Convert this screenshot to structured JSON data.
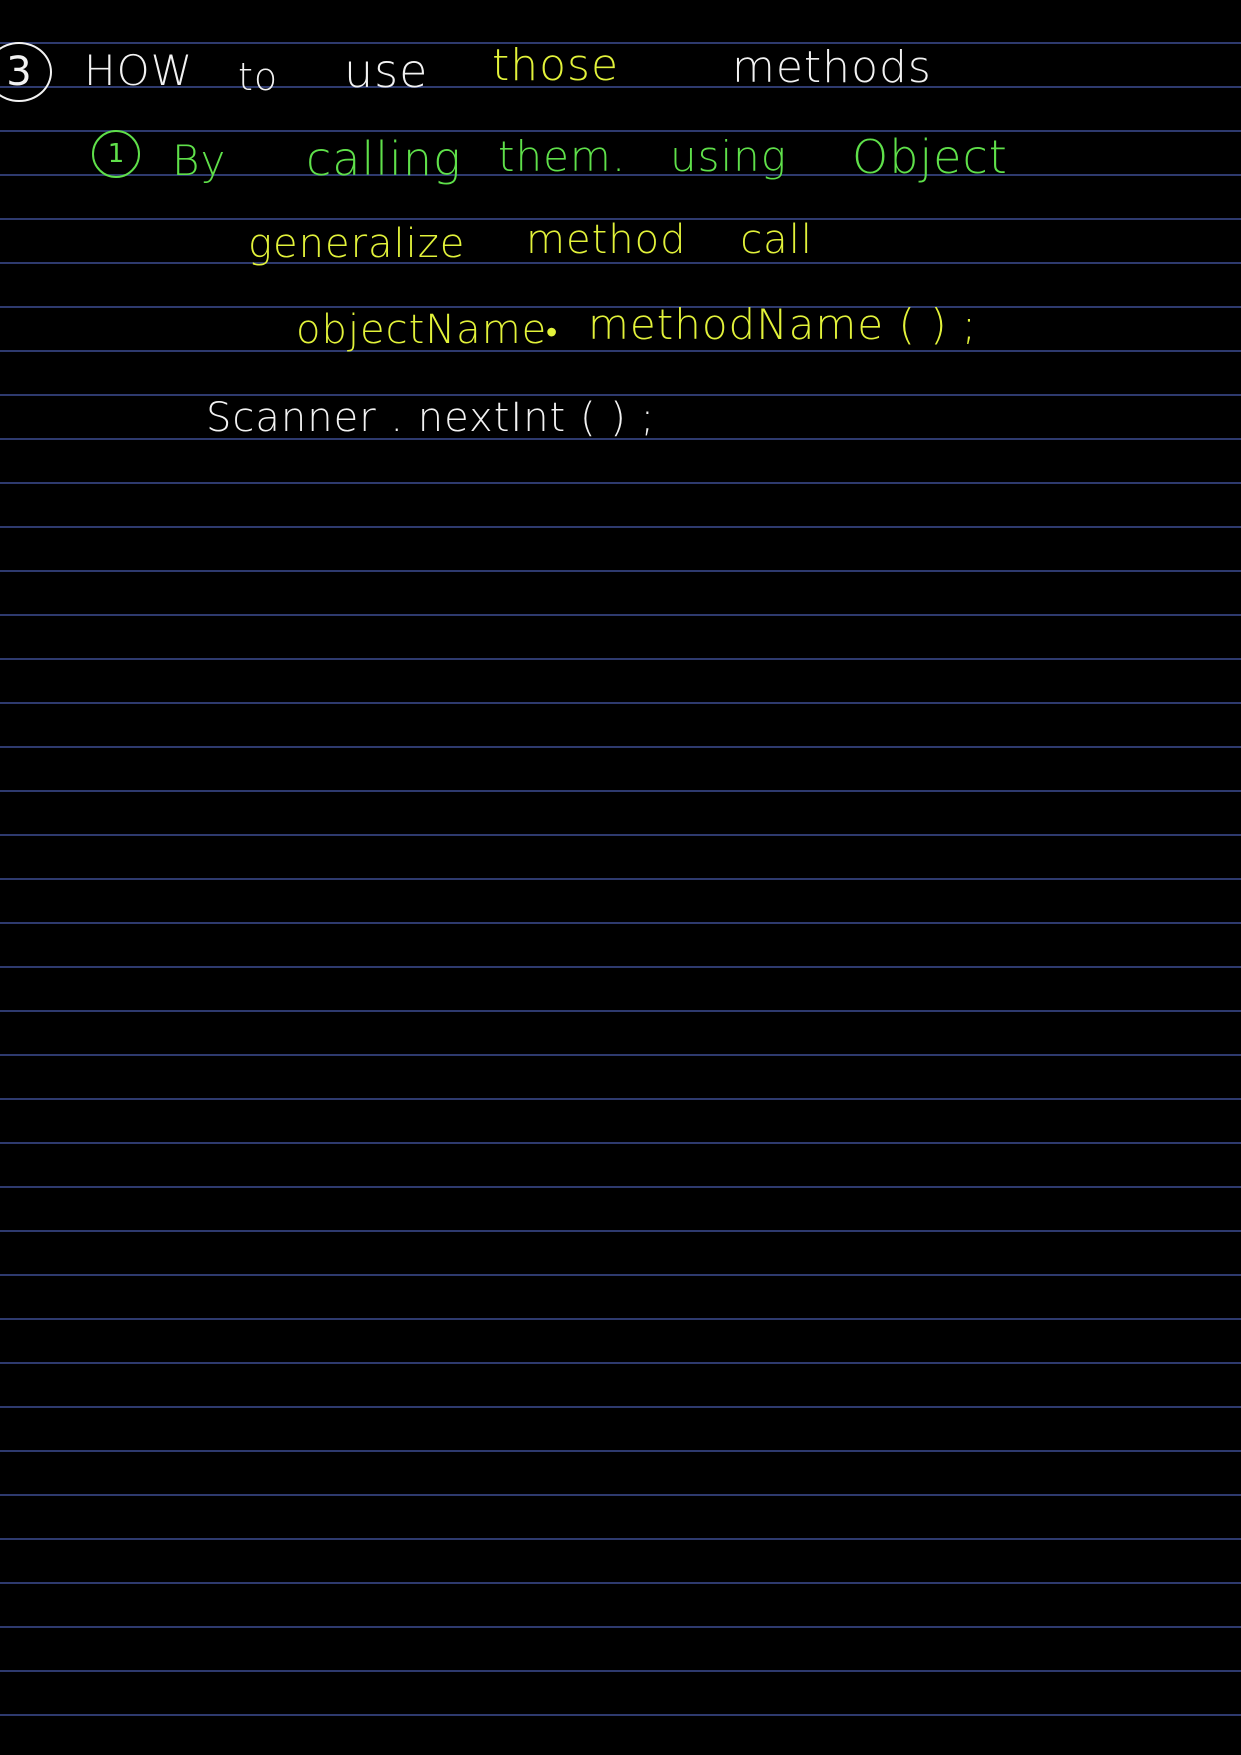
{
  "heading": {
    "number": "3",
    "words": [
      "HOW",
      "to",
      "use"
    ],
    "highlight": "those",
    "last": "methods"
  },
  "point1": {
    "number": "1",
    "words": [
      "By",
      "calling",
      "them.",
      "using",
      "Object"
    ]
  },
  "generalize": {
    "label": "generalize",
    "text": "method call"
  },
  "syntax": {
    "object": "objectName",
    "dot": "•",
    "method": "methodName ( ) ;"
  },
  "example": {
    "text": "Scanner . nextInt ( ) ;"
  },
  "colors": {
    "background": "#000000",
    "rule": "#2e3a6e",
    "white_ink": "#f2f2f2",
    "yellow_ink": "#e2f23a",
    "green_ink": "#5fe04a"
  }
}
